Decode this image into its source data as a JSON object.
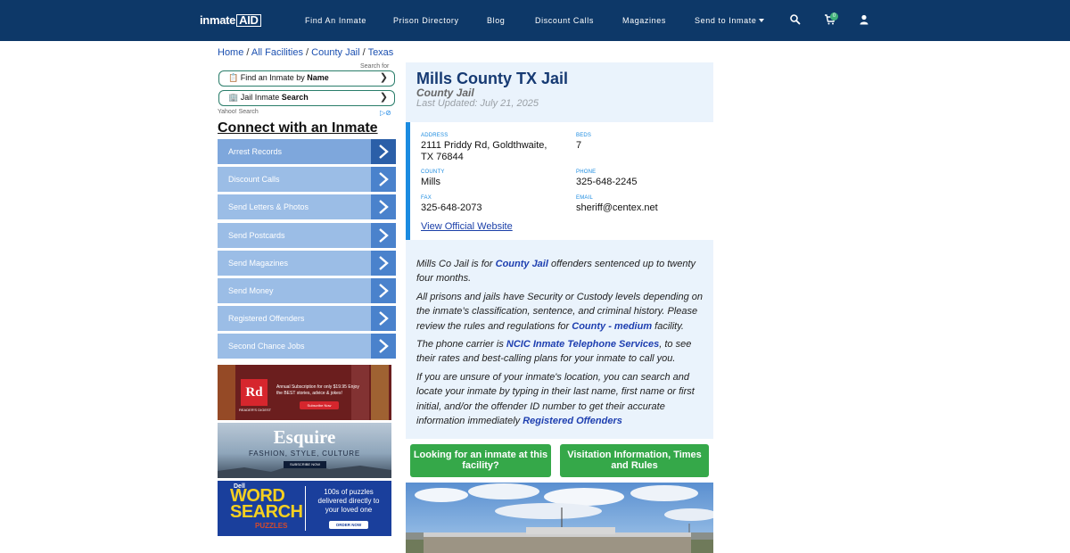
{
  "nav": {
    "logo_prefix": "inmate",
    "logo_box": "AID",
    "items": [
      "Find An Inmate",
      "Prison Directory",
      "Blog",
      "Discount Calls",
      "Magazines",
      "Send to Inmate"
    ],
    "cart_count": "0",
    "icons": [
      "search-icon",
      "cart-icon",
      "user-icon"
    ]
  },
  "breadcrumb": {
    "home": "Home",
    "sep": " / ",
    "all_facilities": "All Facilities",
    "county_jail": "County Jail",
    "state": "Texas"
  },
  "search": {
    "search_for": "Search for",
    "pill1_prefix": "📋 Find an Inmate by ",
    "pill1_bold": "Name",
    "pill2_prefix": "🏢 Jail Inmate ",
    "pill2_bold": "Search",
    "yahoo": "Yahoo! Search"
  },
  "connect": {
    "title": "Connect with an Inmate",
    "items": [
      "Arrest Records",
      "Discount Calls",
      "Send Letters & Photos",
      "Send Postcards",
      "Send Magazines",
      "Send Money",
      "Registered Offenders",
      "Second Chance Jobs"
    ]
  },
  "ads": {
    "rd": {
      "logo": "Rd",
      "brand": "READER'S DIGEST",
      "text": "Annual Subscription for only $19.95 Enjoy the BEST stories, advice & jokes!",
      "button": "Subscribe Now"
    },
    "esquire": {
      "title": "Esquire",
      "subtitle": "FASHION, STYLE, CULTURE",
      "button": "SUBSCRIBE NOW"
    },
    "wordsearch": {
      "brand": "Dell",
      "line1": "WORD",
      "line2": "SEARCH",
      "puzzles": "PUZZLES",
      "text": "100s of puzzles delivered directly to your loved one",
      "button": "ORDER NOW"
    }
  },
  "facility": {
    "title": "Mills County TX Jail",
    "type": "County Jail",
    "updated": "Last Updated: July 21, 2025",
    "address_label": "ADDRESS",
    "address_line1": "2111 Priddy Rd, Goldthwaite,",
    "address_line2": "TX 76844",
    "beds_label": "BEDS",
    "beds": "7",
    "county_label": "COUNTY",
    "county": "Mills",
    "phone_label": "PHONE",
    "phone": "325-648-2245",
    "fax_label": "FAX",
    "fax": "325-648-2073",
    "email_label": "EMAIL",
    "email": "sheriff@centex.net",
    "website_link": "View Official Website"
  },
  "description": {
    "p1_a": "Mills Co Jail is for ",
    "p1_link": "County Jail",
    "p1_b": " offenders sentenced up to twenty four months.",
    "p2_a": "All prisons and jails have Security or Custody levels depending on the inmate’s classification, sentence, and criminal history. Please review the rules and regulations for ",
    "p2_link": "County - medium",
    "p2_b": " facility.",
    "p3_a": "The phone carrier is ",
    "p3_link": "NCIC Inmate Telephone Services",
    "p3_b": ", to see their rates and best-calling plans for your inmate to call you.",
    "p4_a": "If you are unsure of your inmate's location, you can search and locate your inmate by typing in their last name, first name or first initial, and/or the offender ID number to get their accurate information immediately ",
    "p4_link": "Registered Offenders"
  },
  "buttons": {
    "looking": "Looking for an inmate at this facility?",
    "visitation": "Visitation Information, Times and Rules"
  },
  "colors": {
    "nav_bg": "#0d3868",
    "side_item": "#9bbde6",
    "side_arrow": "#4a82cc",
    "panel_bg": "#eaf3fc",
    "accent_blue": "#1b8be0",
    "green_button": "#35a849"
  }
}
